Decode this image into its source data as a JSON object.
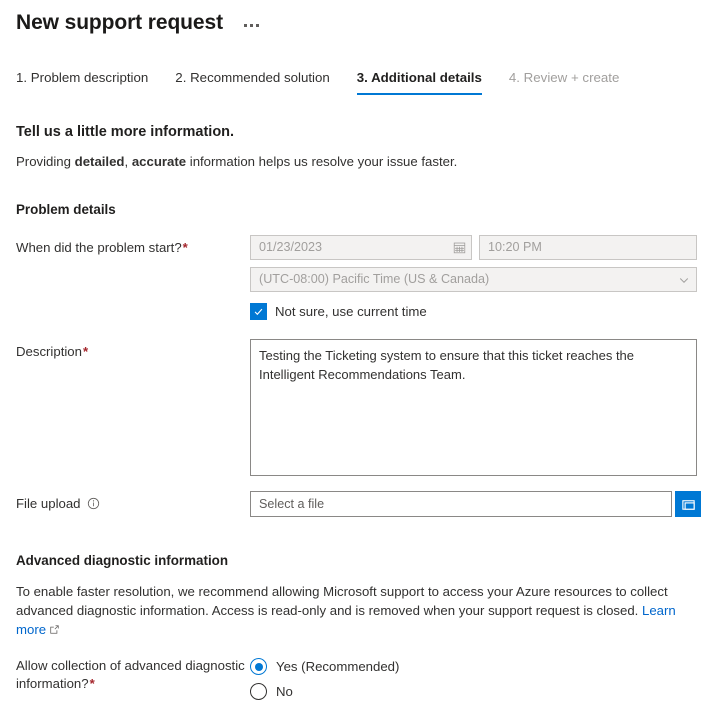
{
  "header": {
    "title": "New support request",
    "more_menu": "…"
  },
  "tabs": [
    {
      "label": "1. Problem description",
      "state": "enabled"
    },
    {
      "label": "2. Recommended solution",
      "state": "enabled"
    },
    {
      "label": "3. Additional details",
      "state": "active"
    },
    {
      "label": "4. Review + create",
      "state": "disabled"
    }
  ],
  "intro": {
    "heading": "Tell us a little more information.",
    "sub_prefix": "Providing ",
    "sub_bold1": "detailed",
    "sub_mid": ", ",
    "sub_bold2": "accurate",
    "sub_suffix": " information helps us resolve your issue faster."
  },
  "problem_details": {
    "section_title": "Problem details",
    "when_label": "When did the problem start?",
    "date_value": "01/23/2023",
    "time_value": "10:20 PM",
    "timezone_value": "(UTC-08:00) Pacific Time (US & Canada)",
    "not_sure_label": "Not sure, use current time",
    "not_sure_checked": true,
    "description_label": "Description",
    "description_value": "Testing the Ticketing system to ensure that this ticket reaches the Intelligent Recommendations Team.",
    "file_upload_label": "File upload",
    "file_placeholder": "Select a file"
  },
  "advanced": {
    "title": "Advanced diagnostic information",
    "paragraph": "To enable faster resolution, we recommend allowing Microsoft support to access your Azure resources to collect advanced diagnostic information. Access is read-only and is removed when your support request is closed. ",
    "learn_more": "Learn more",
    "allow_label": "Allow collection of advanced diagnostic information?",
    "options": [
      {
        "label": "Yes (Recommended)",
        "selected": true
      },
      {
        "label": "No",
        "selected": false
      }
    ]
  },
  "colors": {
    "accent": "#0078d4",
    "link": "#0066cc",
    "required": "#a4262c",
    "disabled_text": "#a19f9d"
  }
}
